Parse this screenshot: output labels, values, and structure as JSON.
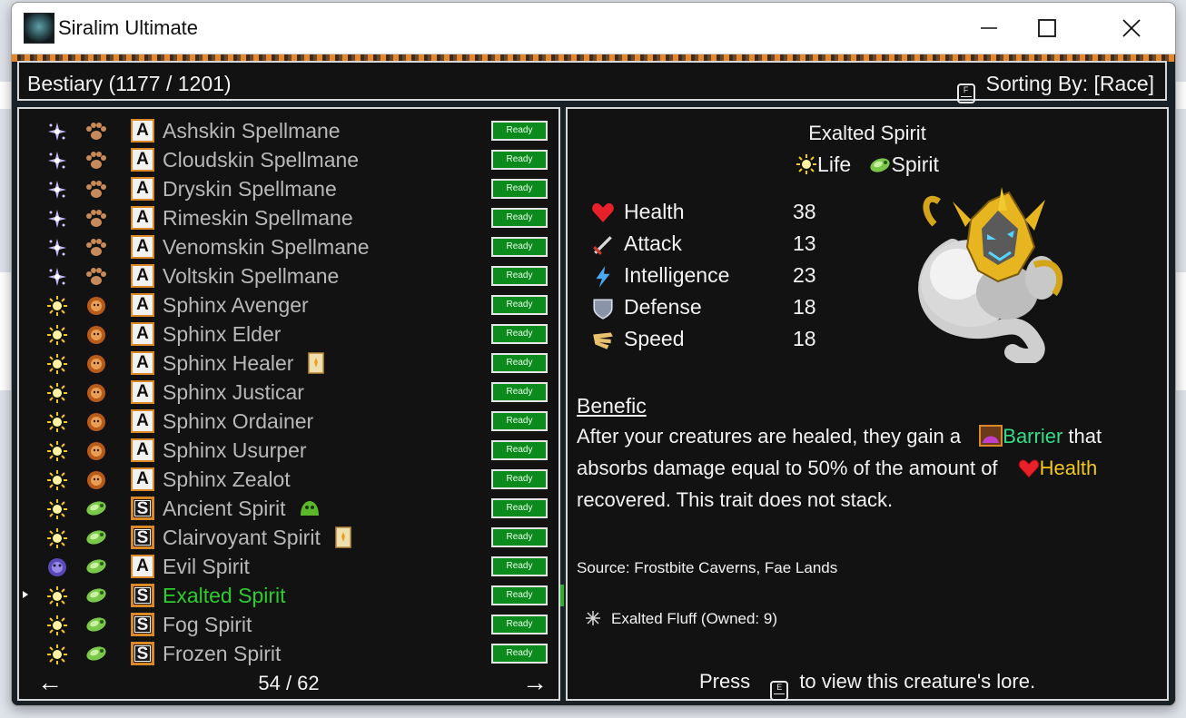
{
  "window": {
    "title": "Siralim Ultimate"
  },
  "header": {
    "bestiary_label": "Bestiary (1177 / 1201)",
    "sort_key": "F",
    "sorting_label": "Sorting By: [Race]"
  },
  "list": {
    "rows": [
      {
        "element": "sorcery",
        "race": "spellmane",
        "class": "A",
        "name": "Ashskin Spellmane",
        "status": "Ready"
      },
      {
        "element": "sorcery",
        "race": "spellmane",
        "class": "A",
        "name": "Cloudskin Spellmane",
        "status": "Ready"
      },
      {
        "element": "sorcery",
        "race": "spellmane",
        "class": "A",
        "name": "Dryskin Spellmane",
        "status": "Ready"
      },
      {
        "element": "sorcery",
        "race": "spellmane",
        "class": "A",
        "name": "Rimeskin Spellmane",
        "status": "Ready"
      },
      {
        "element": "sorcery",
        "race": "spellmane",
        "class": "A",
        "name": "Venomskin Spellmane",
        "status": "Ready"
      },
      {
        "element": "sorcery",
        "race": "spellmane",
        "class": "A",
        "name": "Voltskin Spellmane",
        "status": "Ready"
      },
      {
        "element": "life",
        "race": "sphinx",
        "class": "A",
        "name": "Sphinx Avenger",
        "status": "Ready"
      },
      {
        "element": "life",
        "race": "sphinx",
        "class": "A",
        "name": "Sphinx Elder",
        "status": "Ready"
      },
      {
        "element": "life",
        "race": "sphinx",
        "class": "A",
        "name": "Sphinx Healer",
        "status": "Ready",
        "extra": "card"
      },
      {
        "element": "life",
        "race": "sphinx",
        "class": "A",
        "name": "Sphinx Justicar",
        "status": "Ready"
      },
      {
        "element": "life",
        "race": "sphinx",
        "class": "A",
        "name": "Sphinx Ordainer",
        "status": "Ready"
      },
      {
        "element": "life",
        "race": "sphinx",
        "class": "A",
        "name": "Sphinx Usurper",
        "status": "Ready"
      },
      {
        "element": "life",
        "race": "sphinx",
        "class": "A",
        "name": "Sphinx Zealot",
        "status": "Ready"
      },
      {
        "element": "life",
        "race": "spirit",
        "class": "S",
        "name": "Ancient Spirit",
        "status": "Ready",
        "extra": "slime"
      },
      {
        "element": "life",
        "race": "spirit",
        "class": "S",
        "name": "Clairvoyant Spirit",
        "status": "Ready",
        "extra": "card"
      },
      {
        "element": "death",
        "race": "spirit",
        "class": "A",
        "name": "Evil Spirit",
        "status": "Ready"
      },
      {
        "element": "life",
        "race": "spirit",
        "class": "S",
        "name": "Exalted Spirit",
        "status": "Ready",
        "selected": true
      },
      {
        "element": "life",
        "race": "spirit",
        "class": "S",
        "name": "Fog Spirit",
        "status": "Ready"
      },
      {
        "element": "life",
        "race": "spirit",
        "class": "S",
        "name": "Frozen Spirit",
        "status": "Ready"
      }
    ],
    "prev_arrow": "←",
    "next_arrow": "→",
    "page": "54 / 62"
  },
  "detail": {
    "name": "Exalted Spirit",
    "element": "Life",
    "race": "Spirit",
    "stats": [
      {
        "icon": "heart-icon",
        "label": "Health",
        "value": "38"
      },
      {
        "icon": "sword-icon",
        "label": "Attack",
        "value": "13"
      },
      {
        "icon": "lightning-icon",
        "label": "Intelligence",
        "value": "23"
      },
      {
        "icon": "shield-icon",
        "label": "Defense",
        "value": "18"
      },
      {
        "icon": "wing-icon",
        "label": "Speed",
        "value": "18"
      }
    ],
    "trait_name": "Benefic",
    "trait_desc": {
      "line1_a": "After your creatures are healed, they gain a",
      "line1_barrier": "Barrier",
      "line1_b": "that",
      "line2_a": "absorbs damage equal to 50% of the amount of",
      "line2_health": "Health",
      "line3": "recovered. This trait does not stack."
    },
    "source": "Source: Frostbite Caverns, Fae Lands",
    "material": "Exalted Fluff (Owned: 9)",
    "lore_key": "E",
    "lore_prefix": "Press",
    "lore_suffix": "to view this creature's lore."
  },
  "colors": {
    "selected_name": "#2ecc2e",
    "barrier": "#33dd88",
    "health": "#f2c81a",
    "ready_button": "#0c8a1c",
    "badge_border": "#d88a2a"
  }
}
